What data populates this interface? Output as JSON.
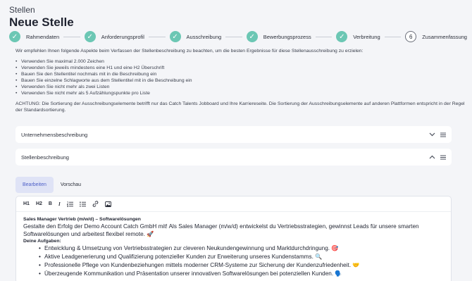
{
  "header": {
    "eyebrow": "Stellen",
    "title": "Neue Stelle"
  },
  "steps": [
    {
      "label": "Rahmendaten",
      "status": "done",
      "icon": "check-icon"
    },
    {
      "label": "Anforderungsprofil",
      "status": "done",
      "icon": "check-icon"
    },
    {
      "label": "Ausschreibung",
      "status": "done",
      "icon": "check-icon"
    },
    {
      "label": "Bewerbungsprozess",
      "status": "done",
      "icon": "check-icon"
    },
    {
      "label": "Verbreitung",
      "status": "done",
      "icon": "check-icon"
    },
    {
      "label": "Zusammenfassung",
      "status": "todo",
      "number": "6"
    }
  ],
  "intro": {
    "lead": "Wir empfehlen Ihnen folgende Aspekte beim Verfassen der Stellenbeschreibung zu beachten, um die besten Ergebnisse für diese Stellenausschreibung zu erzielen:",
    "tips": [
      "Verwenden Sie maximal 2.000 Zeichen",
      "Verwenden Sie jeweils mindestens eine H1 und eine H2 Überschrift",
      "Bauen Sie den Stellentitel nochmals mit in die Beschreibung ein",
      "Bauen Sie einzelne Schlagworte aus dem Stellentitel mit in die Beschreibung ein",
      "Verwenden Sie nicht mehr als zwei Listen",
      "Verwenden Sie nicht mehr als 5 Aufzählungspunkte pro Liste"
    ],
    "warning": "ACHTUNG: Die Sortierung der Ausschreibungselemente betrifft nur das Catch Talents Jobboard und Ihre Karriereseite. Die Sortierung der Ausschreibungselemente auf anderen Plattformen entspricht in der Regel der Standardsortierung."
  },
  "sections": [
    {
      "title": "Unternehmensbeschreibung",
      "state": "collapsed",
      "icon": "chevron-down-icon"
    },
    {
      "title": "Stellenbeschreibung",
      "state": "expanded",
      "icon": "chevron-up-icon"
    }
  ],
  "tabs": {
    "edit": "Bearbeiten",
    "preview": "Vorschau",
    "active": "edit"
  },
  "toolbar": {
    "h1": "H1",
    "h2": "H2",
    "bold": "B",
    "italic": "I"
  },
  "editor": {
    "heading": "Sales Manager Vertrieb (m/w/d) – Softwarelösungen",
    "paragraph": "Gestalte den Erfolg der Demo Account Catch GmbH mit! Als Sales Manager (m/w/d) entwickelst du Vertriebsstrategien, gewinnst Leads für unsere smarten Softwarelösungen und arbeitest flexibel remote. 🚀",
    "tasks_heading": "Deine Aufgaben:",
    "tasks": [
      "Entwicklung & Umsetzung von Vertriebsstrategien zur cleveren Neukundengewinnung und Marktdurchdringung. 🎯",
      "Aktive Leadgenerierung und Qualifizierung potenzieller Kunden zur Erweiterung unseres Kundenstamms. 🔍",
      "Professionelle Pflege von Kundenbeziehungen mittels moderner CRM-Systeme zur Sicherung der Kundenzufriedenheit. 🤝",
      "Überzeugende Kommunikation und Präsentation unserer innovativen Softwarelösungen bei potenziellen Kunden. 🗣️"
    ]
  },
  "colors": {
    "accent": "#6cc7b4",
    "tab_active_bg": "#dfe3f6",
    "tab_active_text": "#4d5fc7",
    "background": "#f4f5f8"
  }
}
